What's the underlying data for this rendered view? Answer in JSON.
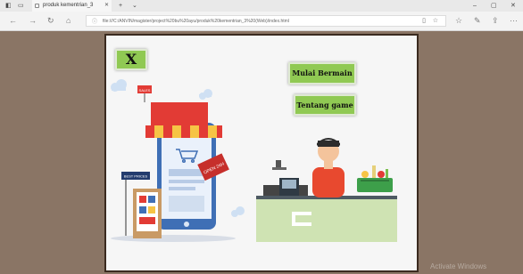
{
  "browser": {
    "tab_title": "produk kementrian_3",
    "url": "file:///C:/ANVIN/magister/project%20bu%20ayu/produk%20kementrian_3%20(Web)/index.html"
  },
  "page": {
    "exit_button": "X",
    "play_button": "Mulai Bermain",
    "about_button": "Tentang game",
    "sign_sales": "SALES",
    "sign_best_prices": "BEST PRICES",
    "sign_open": "OPEN 24H"
  },
  "watermark": "Activate Windows",
  "colors": {
    "button_green": "#90c953",
    "awning_red": "#e23b35",
    "awning_yellow": "#f6c445",
    "phone_blue": "#3f6fb5",
    "counter_green": "#cfe3b3"
  },
  "icons": [
    "back-arrow-icon",
    "forward-arrow-icon",
    "refresh-icon",
    "home-icon",
    "info-icon",
    "reading-view-icon",
    "favorite-star-icon",
    "hub-icon",
    "pen-icon",
    "share-icon",
    "more-icon"
  ]
}
